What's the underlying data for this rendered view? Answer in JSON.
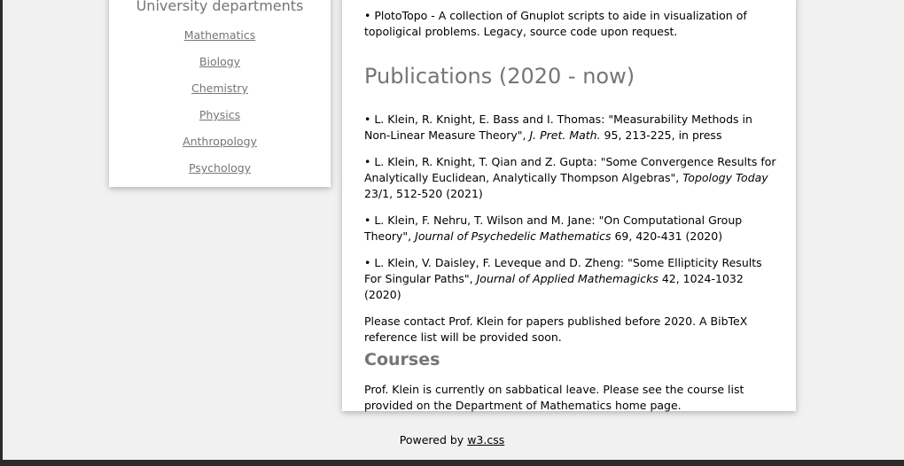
{
  "sidebar": {
    "title": "University departments",
    "departments": [
      "Mathematics",
      "Biology",
      "Chemistry",
      "Physics",
      "Anthropology",
      "Psychology"
    ]
  },
  "main": {
    "software_item": "• PlotoTopo - A collection of Gnuplot scripts to aide in visualization of topoligical problems. Legacy, source code upon request.",
    "publications_heading": "Publications (2020 - now)",
    "publications": [
      {
        "authors": "• L. Klein, R. Knight, E. Bass and I. Thomas: \"Measurability Methods in Non-Linear Measure Theory\", ",
        "journal": "J. Pret. Math.",
        "details": " 95, 213-225, in press"
      },
      {
        "authors": "• L. Klein, R. Knight, T. Qian and Z. Gupta: \"Some Convergence Results for Analytically Euclidean, Analytically Thompson Algebras\", ",
        "journal": "Topology Today",
        "details": " 23/1, 512-520 (2021)"
      },
      {
        "authors": "• L. Klein, F. Nehru, T. Wilson and M. Jane: \"On Computational Group Theory\", ",
        "journal": "Journal of Psychedelic Mathematics",
        "details": " 69, 420-431 (2020)"
      },
      {
        "authors": "• L. Klein, V. Daisley, F. Leveque and D. Zheng: \"Some Ellipticity Results For Singular Paths\", ",
        "journal": "Journal of Applied Mathemagicks",
        "details": " 42, 1024-1032 (2020)"
      }
    ],
    "contact_note": "Please contact Prof. Klein for papers published before 2020. A BibTeX reference list will be provided soon.",
    "courses_heading": "Courses",
    "courses_text": "Prof. Klein is currently on sabbatical leave. Please see the course list provided on the Department of Mathematics home page."
  },
  "footer": {
    "powered_by": "Powered by ",
    "link_label": "w3.css"
  }
}
